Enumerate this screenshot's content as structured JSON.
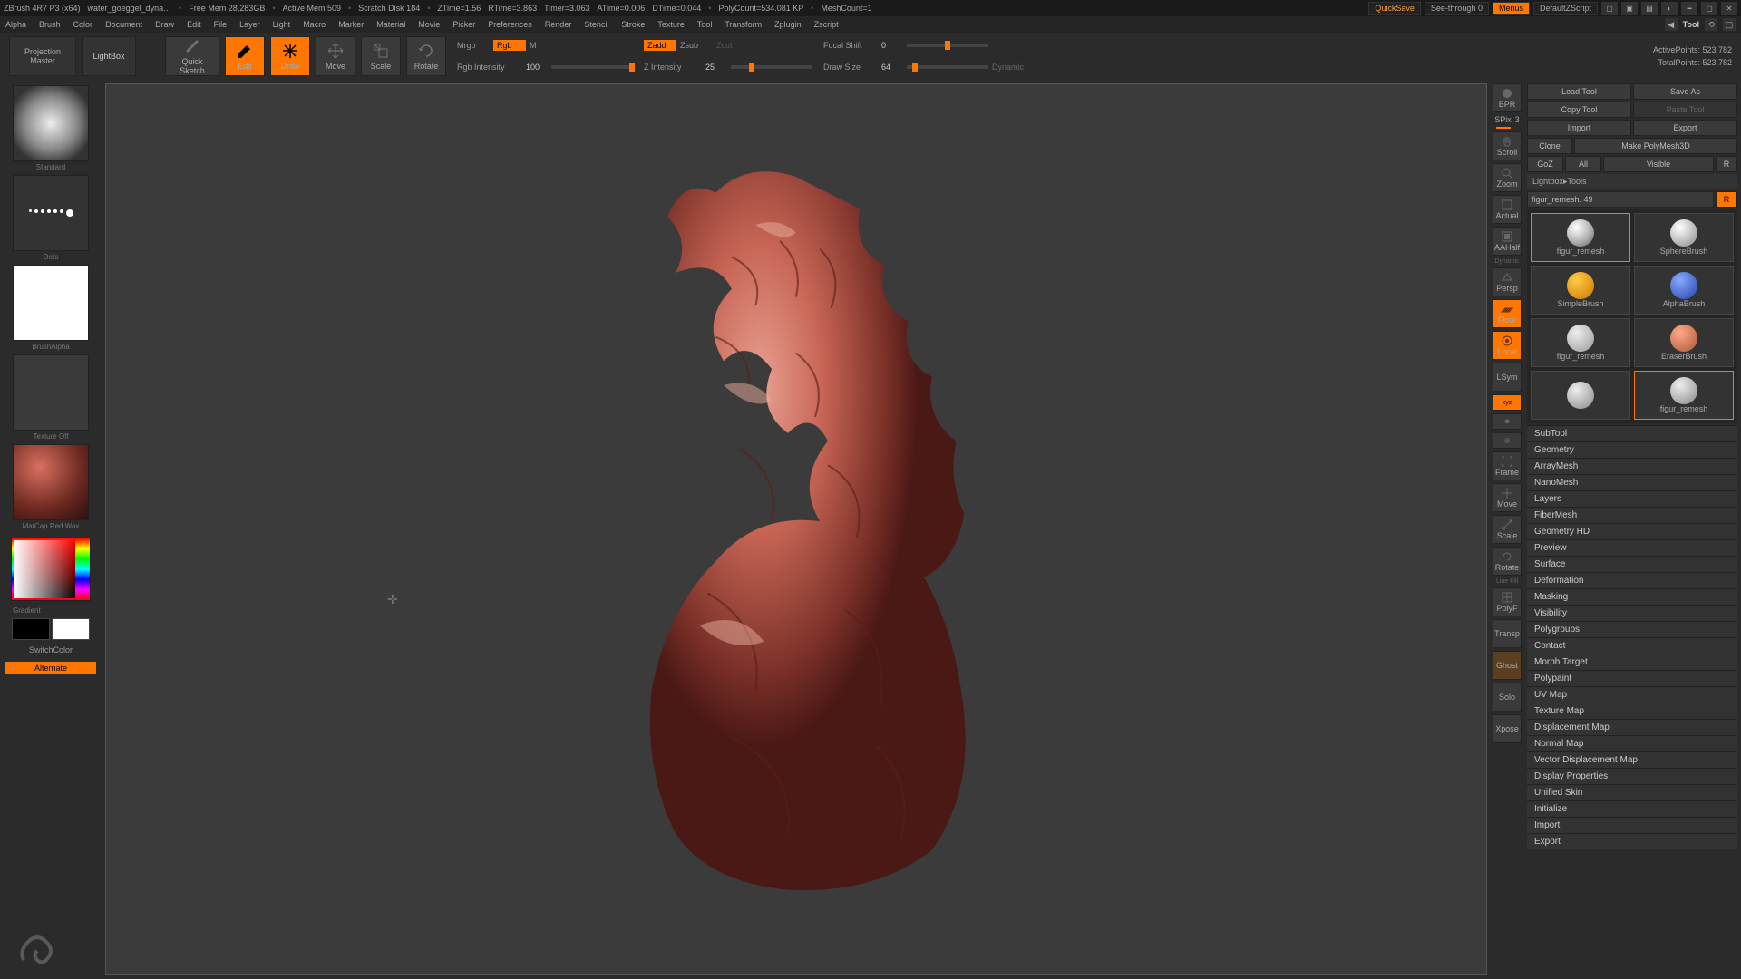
{
  "title": {
    "app": "ZBrush 4R7 P3 (x64)",
    "file": "water_goeggel_dyna…",
    "freemem": "Free Mem 28,283GB",
    "activemem": "Active Mem 509",
    "scratch": "Scratch Disk 184",
    "ztime": "ZTime=1.56",
    "rtime": "RTime=3.863",
    "timer": "Timer=3.063",
    "atime": "ATime=0.006",
    "dtime": "DTime=0.044",
    "polycount": "PolyCount=534.081 KP",
    "meshcount": "MeshCount=1",
    "quicksave": "QuickSave",
    "seethrough": "See-through",
    "seethrough_val": "0",
    "menus": "Menus",
    "script": "DefaultZScript"
  },
  "menu": [
    "Alpha",
    "Brush",
    "Color",
    "Document",
    "Draw",
    "Edit",
    "File",
    "Layer",
    "Light",
    "Macro",
    "Marker",
    "Material",
    "Movie",
    "Picker",
    "Preferences",
    "Render",
    "Stencil",
    "Stroke",
    "Texture",
    "Tool",
    "Transform",
    "Zplugin",
    "Zscript"
  ],
  "panel_name": "Tool",
  "toolbar": {
    "projection": "Projection\nMaster",
    "lightbox": "LightBox",
    "quicksketch": "Quick\nSketch",
    "edit": "Edit",
    "draw": "Draw",
    "move": "Move",
    "scale": "Scale",
    "rotate": "Rotate",
    "mrgb": "Mrgb",
    "rgb": "Rgb",
    "m": "M",
    "rgb_int_lbl": "Rgb Intensity",
    "rgb_int_val": "100",
    "zadd": "Zadd",
    "zsub": "Zsub",
    "zcut": "Zcut",
    "z_int_lbl": "Z Intensity",
    "z_int_val": "25",
    "focal_lbl": "Focal Shift",
    "focal_val": "0",
    "drawsize_lbl": "Draw Size",
    "drawsize_val": "64",
    "dynamic": "Dynamic",
    "activepoints": "ActivePoints: 523,782",
    "totalpoints": "TotalPoints: 523,782"
  },
  "left": {
    "brush": "Standard",
    "stroke": "Dots",
    "alpha": "BrushAlpha",
    "texture": "Texture Off",
    "material": "MatCap Red Wax",
    "gradient": "Gradient",
    "switchcolor": "SwitchColor",
    "alternate": "Alternate"
  },
  "nav": {
    "bpr": "BPR",
    "scroll": "Scroll",
    "zoom": "Zoom",
    "actual": "Actual",
    "aahalf": "AAHalf",
    "persp": "Persp",
    "floor": "Floor",
    "local": "Local",
    "lsym": "LSym",
    "xyz": "xyz",
    "frame": "Frame",
    "move": "Move",
    "scale": "Scale",
    "rotate": "Rotate",
    "polyf": "PolyF",
    "transp": "Transp",
    "ghost": "Ghost",
    "solo": "Solo",
    "xpose": "Xpose",
    "spix_lbl": "SPix",
    "spix_val": "3",
    "dynamic": "Dynamic",
    "linefill": "Line Fill"
  },
  "tool": {
    "load": "Load Tool",
    "saveas": "Save As",
    "copy": "Copy Tool",
    "paste": "Paste Tool",
    "import": "Import",
    "export": "Export",
    "clone": "Clone",
    "makepoly": "Make PolyMesh3D",
    "goz": "GoZ",
    "all": "All",
    "visible": "Visible",
    "r": "R",
    "lightboxtools": "Lightbox▸Tools",
    "current": "figur_remesh. 49",
    "rbtn": "R",
    "thumbs": [
      "figur_remesh",
      "SphereBrush",
      "SimpleBrush",
      "AlphaBrush",
      "figur_remesh",
      "EraserBrush",
      "",
      "figur_remesh"
    ]
  },
  "sections": [
    "SubTool",
    "Geometry",
    "ArrayMesh",
    "NanoMesh",
    "Layers",
    "FiberMesh",
    "Geometry HD",
    "Preview",
    "Surface",
    "Deformation",
    "Masking",
    "Visibility",
    "Polygroups",
    "Contact",
    "Morph Target",
    "Polypaint",
    "UV Map",
    "Texture Map",
    "Displacement Map",
    "Normal Map",
    "Vector Displacement Map",
    "Display Properties",
    "Unified Skin",
    "Initialize",
    "Import",
    "Export"
  ]
}
